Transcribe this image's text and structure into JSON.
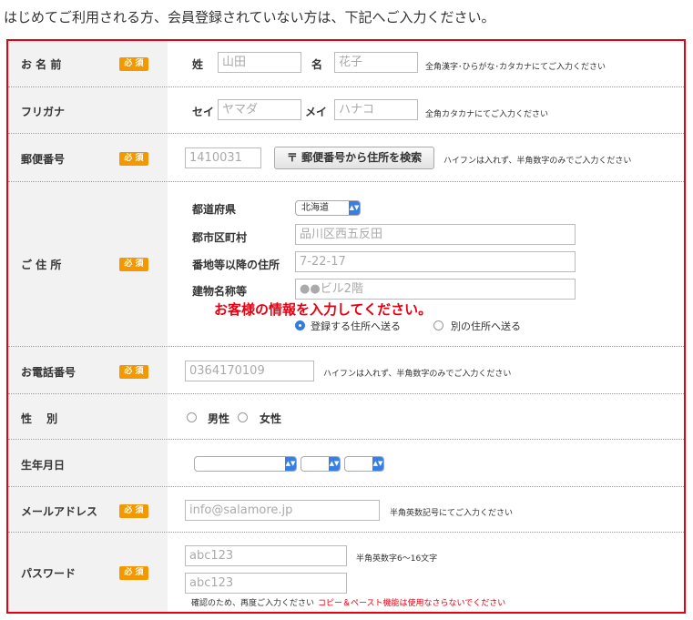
{
  "heading": "はじめてご利用される方、会員登録されていない方は、下記へご入力ください。",
  "required_badge": "必 須",
  "colors": {
    "frame": "#e60012",
    "badge": "#f39800",
    "label_bg": "#f2f2f2",
    "accent": "#2f7de1"
  },
  "name": {
    "label": "お 名 前",
    "sei_label": "姓",
    "sei_placeholder": "山田",
    "mei_label": "名",
    "mei_placeholder": "花子",
    "note": "全角漢字･ひらがな･カタカナにてご入力ください"
  },
  "kana": {
    "label": "フリガナ",
    "sei_label": "セイ",
    "sei_placeholder": "ヤマダ",
    "mei_label": "メイ",
    "mei_placeholder": "ハナコ",
    "note": "全角カタカナにてご入力ください"
  },
  "postal": {
    "label": "郵便番号",
    "placeholder": "1410031",
    "search_button": "〒 郵便番号から住所を検索",
    "note": "ハイフンは入れず、半角数字のみでご入力ください"
  },
  "address": {
    "label": "ご 住 所",
    "pref_label": "都道府県",
    "pref_value": "北海道",
    "city_label": "郡市区町村",
    "city_placeholder": "品川区西五反田",
    "street_label": "番地等以降の住所",
    "street_placeholder": "7-22-17",
    "building_label": "建物名称等",
    "building_placeholder": "●●ビル2階",
    "banner": "お客様の情報を入力してください。",
    "ship_registered": "登録する住所へ送る",
    "ship_other": "別の住所へ送る"
  },
  "phone": {
    "label": "お電話番号",
    "placeholder": "0364170109",
    "note": "ハイフンは入れず、半角数字のみでご入力ください"
  },
  "gender": {
    "label": "性　 別",
    "male": "男性",
    "female": "女性"
  },
  "birthday": {
    "label": "生年月日"
  },
  "email": {
    "label": "メールアドレス",
    "placeholder": "info@salamore.jp",
    "note": "半角英数記号にてご入力ください"
  },
  "password": {
    "label": "パスワード",
    "placeholder": "abc123",
    "confirm_placeholder": "abc123",
    "note": "半角英数字6～16文字",
    "confirm_note": "確認のため、再度ご入力ください",
    "warning": "コピー＆ペースト機能は使用なさらないでください"
  }
}
